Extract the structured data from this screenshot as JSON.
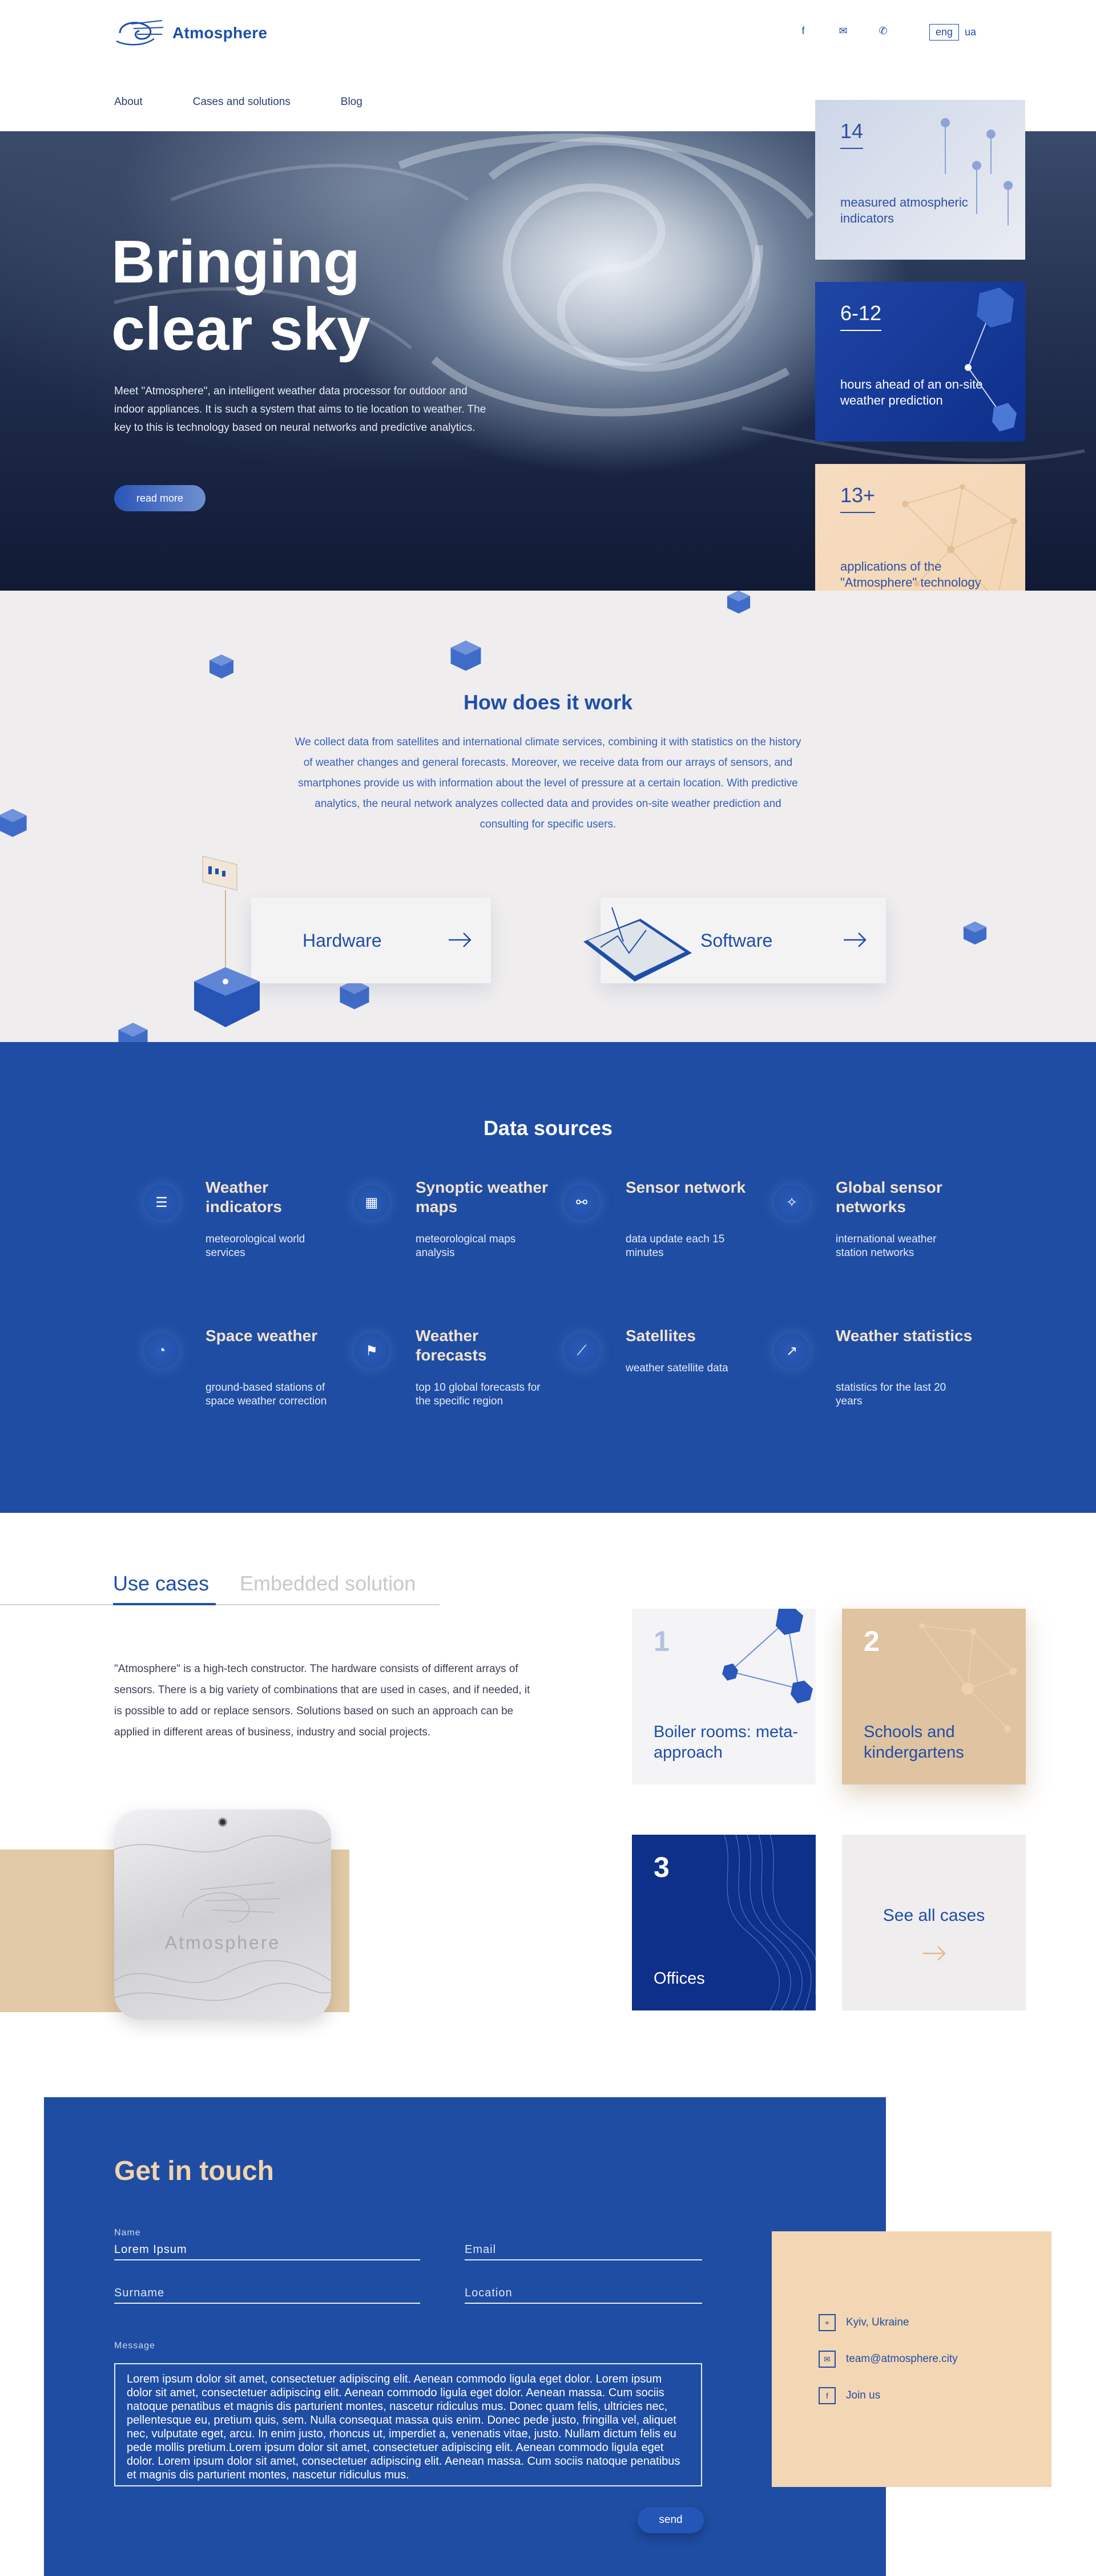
{
  "header": {
    "brand": "Atmosphere",
    "socials": [
      {
        "icon": "facebook-icon",
        "glyph": "f"
      },
      {
        "icon": "mail-icon",
        "glyph": "✉"
      },
      {
        "icon": "phone-icon",
        "glyph": "✆"
      }
    ],
    "lang_active": "eng",
    "lang_other": "ua",
    "nav": [
      "About",
      "Cases and solutions",
      "Blog"
    ]
  },
  "hero": {
    "title_line1": "Bringing",
    "title_line2": "clear sky",
    "text": "Meet \"Atmosphere\", an intelligent weather data processor for outdoor and indoor appliances. It is such a system that aims to tie location to weather. The key to this is technology based on neural networks and predictive analytics.",
    "button": "read more"
  },
  "stats": [
    {
      "num": "14",
      "label": "measured atmospheric indicators"
    },
    {
      "num": "6-12",
      "label": "hours ahead of an on-site weather prediction"
    },
    {
      "num": "13+",
      "label": "applications of the \"Atmosphere\" technology"
    }
  ],
  "how": {
    "title": "How does it work",
    "text": "We collect data from satellites and international climate services, combining it with statistics on the history of weather changes and general forecasts. Moreover, we receive data from our arrays of sensors, and smartphones provide us with information about the level of pressure at a certain location. With predictive analytics, the neural network analyzes collected data and provides on-site weather prediction and consulting for specific users.",
    "hardware": "Hardware",
    "software": "Software"
  },
  "data_sources": {
    "title": "Data sources",
    "items": [
      {
        "name": "Weather indicators",
        "desc": "meteorological world services",
        "icon": "sliders-icon"
      },
      {
        "name": "Synoptic weather maps",
        "desc": "meteorological maps analysis",
        "icon": "map-icon"
      },
      {
        "name": "Sensor network",
        "desc": "data update each 15 minutes",
        "icon": "network-icon"
      },
      {
        "name": "Global sensor networks",
        "desc": "international weather station networks",
        "icon": "global-network-icon"
      },
      {
        "name": "Space weather",
        "desc": "ground-based stations of space weather correction",
        "icon": "satellite-dish-icon"
      },
      {
        "name": "Weather forecasts",
        "desc": "top 10 global forecasts for the specific region",
        "icon": "windsock-icon"
      },
      {
        "name": "Satellites",
        "desc": "weather satellite data",
        "icon": "satellite-icon"
      },
      {
        "name": "Weather statistics",
        "desc": "statistics for the last 20 years",
        "icon": "chart-icon"
      }
    ]
  },
  "use_cases": {
    "tab_active": "Use cases",
    "tab_other": "Embedded solution",
    "text": "\"Atmosphere\" is a high-tech constructor. The hardware consists of different arrays of sensors. There is a big variety of combinations that are used in cases, and if needed, it is possible to add or replace sensors. Solutions based on such an approach can be applied in different areas of business, industry and social projects.",
    "device_brand": "Atmosphere",
    "cases": [
      {
        "num": "1",
        "title": "Boiler rooms: meta-approach"
      },
      {
        "num": "2",
        "title": "Schools and kindergartens"
      },
      {
        "num": "3",
        "title": "Offices"
      }
    ],
    "see_all": "See all cases"
  },
  "contact": {
    "title": "Get in touch",
    "name_label": "Name",
    "name_value": "Lorem Ipsum",
    "email_placeholder": "Email",
    "surname_placeholder": "Surname",
    "location_placeholder": "Location",
    "message_label": "Message",
    "message_value": "Lorem ipsum dolor sit amet, consectetuer adipiscing elit. Aenean commodo ligula eget dolor. Lorem ipsum dolor sit amet, consectetuer adipiscing elit. Aenean commodo ligula eget dolor. Aenean massa. Cum sociis natoque penatibus et magnis dis parturient montes, nascetur ridiculus mus. Donec quam felis, ultricies nec, pellentesque eu, pretium quis, sem. Nulla consequat massa quis enim. Donec pede justo, fringilla vel, aliquet nec, vulputate eget, arcu. In enim justo, rhoncus ut, imperdiet a, venenatis vitae, justo. Nullam dictum felis eu pede mollis pretium.Lorem ipsum dolor sit amet, consectetuer adipiscing elit. Aenean commodo ligula eget dolor. Lorem ipsum dolor sit amet, consectetuer adipiscing elit. Aenean massa. Cum sociis natoque penatibus et magnis dis parturient montes, nascetur ridiculus mus.",
    "send": "send",
    "location": "Kyiv, Ukraine",
    "email": "team@atmosphere.city",
    "join": "Join us"
  },
  "colors": {
    "brand_blue": "#1f4da3",
    "beige": "#f3d6b3",
    "dark_blue": "#0e2f8a"
  }
}
